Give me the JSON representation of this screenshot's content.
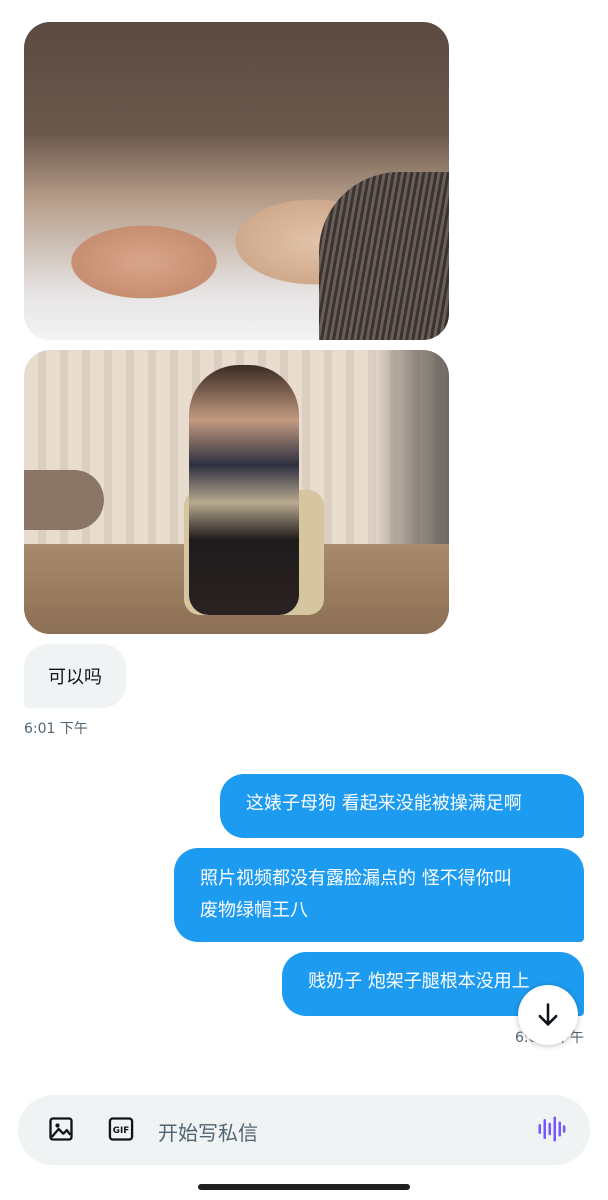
{
  "messages": {
    "incoming": {
      "text": "可以吗",
      "time": "6:01 下午"
    },
    "outgoing": [
      {
        "text": "这婊子母狗 看起来没能被操满足啊"
      },
      {
        "line1": "照片视频都没有露脸漏点的 怪不得你叫",
        "line2": "废物绿帽王八"
      },
      {
        "text": "贱奶子 炮架子腿根本没用上"
      }
    ],
    "outgoing_time": "6:0… 下午"
  },
  "composer": {
    "placeholder": "开始写私信",
    "gif_label": "GIF"
  },
  "icons": {
    "image": "image-icon",
    "gif": "gif-icon",
    "voice": "voice-wave-icon",
    "scroll": "arrow-down-icon"
  },
  "colors": {
    "accent": "#1d9bf0",
    "incoming_bubble": "#eff3f4",
    "voice": "#7856ff"
  }
}
